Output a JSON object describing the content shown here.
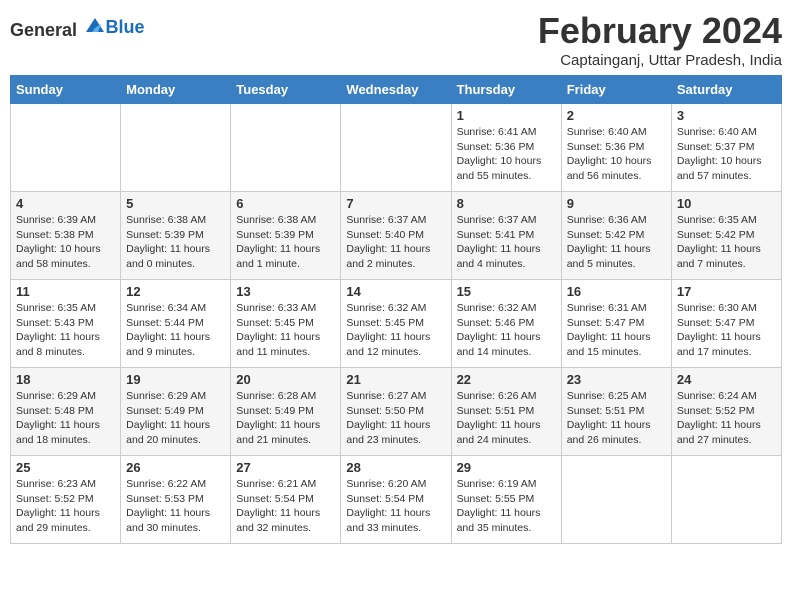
{
  "header": {
    "logo_general": "General",
    "logo_blue": "Blue",
    "title": "February 2024",
    "subtitle": "Captainganj, Uttar Pradesh, India"
  },
  "days_of_week": [
    "Sunday",
    "Monday",
    "Tuesday",
    "Wednesday",
    "Thursday",
    "Friday",
    "Saturday"
  ],
  "weeks": [
    [
      {
        "date": "",
        "info": ""
      },
      {
        "date": "",
        "info": ""
      },
      {
        "date": "",
        "info": ""
      },
      {
        "date": "",
        "info": ""
      },
      {
        "date": "1",
        "info": "Sunrise: 6:41 AM\nSunset: 5:36 PM\nDaylight: 10 hours and 55 minutes."
      },
      {
        "date": "2",
        "info": "Sunrise: 6:40 AM\nSunset: 5:36 PM\nDaylight: 10 hours and 56 minutes."
      },
      {
        "date": "3",
        "info": "Sunrise: 6:40 AM\nSunset: 5:37 PM\nDaylight: 10 hours and 57 minutes."
      }
    ],
    [
      {
        "date": "4",
        "info": "Sunrise: 6:39 AM\nSunset: 5:38 PM\nDaylight: 10 hours and 58 minutes."
      },
      {
        "date": "5",
        "info": "Sunrise: 6:38 AM\nSunset: 5:39 PM\nDaylight: 11 hours and 0 minutes."
      },
      {
        "date": "6",
        "info": "Sunrise: 6:38 AM\nSunset: 5:39 PM\nDaylight: 11 hours and 1 minute."
      },
      {
        "date": "7",
        "info": "Sunrise: 6:37 AM\nSunset: 5:40 PM\nDaylight: 11 hours and 2 minutes."
      },
      {
        "date": "8",
        "info": "Sunrise: 6:37 AM\nSunset: 5:41 PM\nDaylight: 11 hours and 4 minutes."
      },
      {
        "date": "9",
        "info": "Sunrise: 6:36 AM\nSunset: 5:42 PM\nDaylight: 11 hours and 5 minutes."
      },
      {
        "date": "10",
        "info": "Sunrise: 6:35 AM\nSunset: 5:42 PM\nDaylight: 11 hours and 7 minutes."
      }
    ],
    [
      {
        "date": "11",
        "info": "Sunrise: 6:35 AM\nSunset: 5:43 PM\nDaylight: 11 hours and 8 minutes."
      },
      {
        "date": "12",
        "info": "Sunrise: 6:34 AM\nSunset: 5:44 PM\nDaylight: 11 hours and 9 minutes."
      },
      {
        "date": "13",
        "info": "Sunrise: 6:33 AM\nSunset: 5:45 PM\nDaylight: 11 hours and 11 minutes."
      },
      {
        "date": "14",
        "info": "Sunrise: 6:32 AM\nSunset: 5:45 PM\nDaylight: 11 hours and 12 minutes."
      },
      {
        "date": "15",
        "info": "Sunrise: 6:32 AM\nSunset: 5:46 PM\nDaylight: 11 hours and 14 minutes."
      },
      {
        "date": "16",
        "info": "Sunrise: 6:31 AM\nSunset: 5:47 PM\nDaylight: 11 hours and 15 minutes."
      },
      {
        "date": "17",
        "info": "Sunrise: 6:30 AM\nSunset: 5:47 PM\nDaylight: 11 hours and 17 minutes."
      }
    ],
    [
      {
        "date": "18",
        "info": "Sunrise: 6:29 AM\nSunset: 5:48 PM\nDaylight: 11 hours and 18 minutes."
      },
      {
        "date": "19",
        "info": "Sunrise: 6:29 AM\nSunset: 5:49 PM\nDaylight: 11 hours and 20 minutes."
      },
      {
        "date": "20",
        "info": "Sunrise: 6:28 AM\nSunset: 5:49 PM\nDaylight: 11 hours and 21 minutes."
      },
      {
        "date": "21",
        "info": "Sunrise: 6:27 AM\nSunset: 5:50 PM\nDaylight: 11 hours and 23 minutes."
      },
      {
        "date": "22",
        "info": "Sunrise: 6:26 AM\nSunset: 5:51 PM\nDaylight: 11 hours and 24 minutes."
      },
      {
        "date": "23",
        "info": "Sunrise: 6:25 AM\nSunset: 5:51 PM\nDaylight: 11 hours and 26 minutes."
      },
      {
        "date": "24",
        "info": "Sunrise: 6:24 AM\nSunset: 5:52 PM\nDaylight: 11 hours and 27 minutes."
      }
    ],
    [
      {
        "date": "25",
        "info": "Sunrise: 6:23 AM\nSunset: 5:52 PM\nDaylight: 11 hours and 29 minutes."
      },
      {
        "date": "26",
        "info": "Sunrise: 6:22 AM\nSunset: 5:53 PM\nDaylight: 11 hours and 30 minutes."
      },
      {
        "date": "27",
        "info": "Sunrise: 6:21 AM\nSunset: 5:54 PM\nDaylight: 11 hours and 32 minutes."
      },
      {
        "date": "28",
        "info": "Sunrise: 6:20 AM\nSunset: 5:54 PM\nDaylight: 11 hours and 33 minutes."
      },
      {
        "date": "29",
        "info": "Sunrise: 6:19 AM\nSunset: 5:55 PM\nDaylight: 11 hours and 35 minutes."
      },
      {
        "date": "",
        "info": ""
      },
      {
        "date": "",
        "info": ""
      }
    ]
  ]
}
